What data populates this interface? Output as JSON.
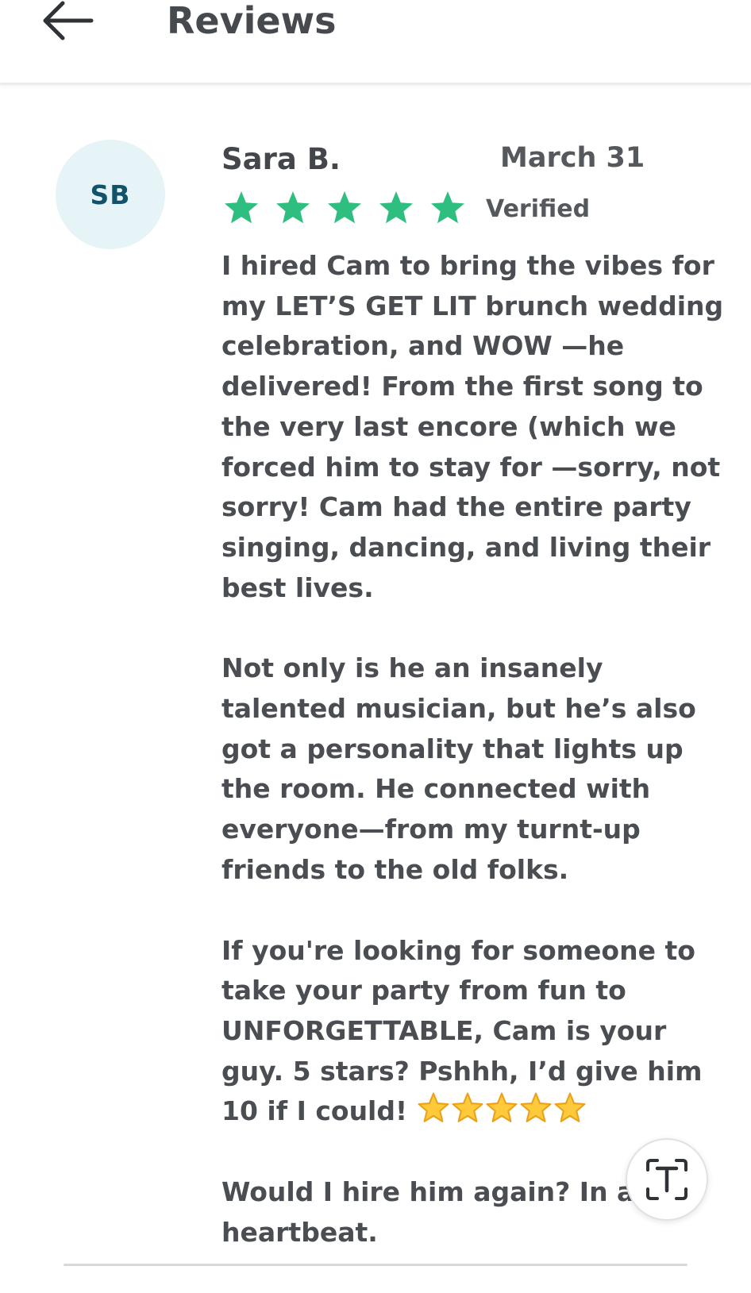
{
  "header": {
    "title": "Reviews",
    "back_icon": "arrow-left-icon"
  },
  "review": {
    "avatar_initials": "SB",
    "reviewer_name": "Sara B.",
    "date": "March 31",
    "rating": 5,
    "rating_max": 5,
    "verified_label": "Verified",
    "paragraphs": [
      "I hired Cam to bring the vibes for my LET’S GET LIT brunch wedding celebration, and WOW —he delivered! From the first song to the very last encore (which we forced him to stay for —sorry, not sorry!  Cam had the entire party singing, dancing, and living their best lives.",
      "Not only is he an insanely talented musician, but he’s also got a personality that lights up the room. He connected with everyone—from my turnt-up friends to the old folks.",
      "If you're looking for someone to take your party from fun to UNFORGETTABLE, Cam is your guy. 5 stars? Pshhh, I’d give him 10 if I could!",
      "Would I hire him again? In a heartbeat."
    ],
    "emoji_star_count": 5
  },
  "floating_button": {
    "icon": "text-scan-icon"
  },
  "colors": {
    "star_green": "#2ebf80",
    "avatar_bg": "#e6f3f7",
    "avatar_text": "#11546a",
    "text": "#4a4d52",
    "emoji_star": "#ffc93c"
  }
}
